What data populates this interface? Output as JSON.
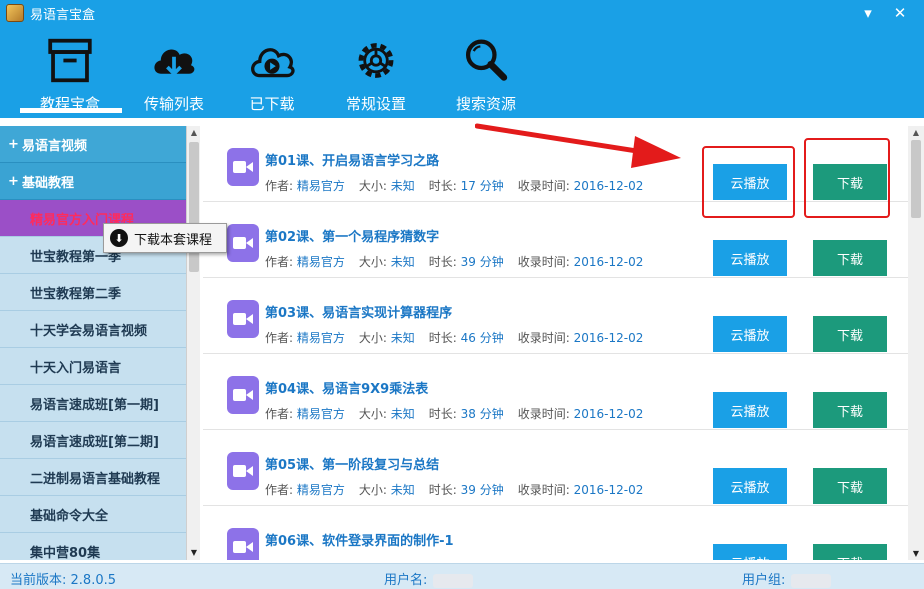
{
  "window": {
    "title": "易语言宝盒",
    "minimize_glyph": "▾",
    "close_glyph": "✕"
  },
  "toolbar": {
    "tabs": [
      {
        "label": "教程宝盒",
        "icon": "box-icon"
      },
      {
        "label": "传输列表",
        "icon": "cloud-download-icon"
      },
      {
        "label": "已下载",
        "icon": "cloud-play-icon"
      },
      {
        "label": "常规设置",
        "icon": "gear-icon"
      },
      {
        "label": "搜索资源",
        "icon": "search-icon"
      }
    ],
    "active_index": 0
  },
  "sidebar": {
    "groups": [
      {
        "label": "易语言视频",
        "expander": "+"
      },
      {
        "label": "基础教程",
        "expander": "+"
      }
    ],
    "items": [
      "精易官方入门课程",
      "世宝教程第一季",
      "世宝教程第二季",
      "十天学会易语言视频",
      "十天入门易语言",
      "易语言速成班[第一期]",
      "易语言速成班[第二期]",
      "二进制易语言基础教程",
      "基础命令大全",
      "集中营80集"
    ],
    "selected_index": 0
  },
  "context_menu": {
    "label": "下载本套课程"
  },
  "course_meta_labels": {
    "author": "作者:",
    "size": "大小:",
    "duration": "时长:",
    "date": "收录时间:"
  },
  "courses": [
    {
      "title": "第01课、开启易语言学习之路",
      "author": "精易官方",
      "size": "未知",
      "duration": "17 分钟",
      "date": "2016-12-02"
    },
    {
      "title": "第02课、第一个易程序猜数字",
      "author": "精易官方",
      "size": "未知",
      "duration": "39 分钟",
      "date": "2016-12-02"
    },
    {
      "title": "第03课、易语言实现计算器程序",
      "author": "精易官方",
      "size": "未知",
      "duration": "46 分钟",
      "date": "2016-12-02"
    },
    {
      "title": "第04课、易语言9X9乘法表",
      "author": "精易官方",
      "size": "未知",
      "duration": "38 分钟",
      "date": "2016-12-02"
    },
    {
      "title": "第05课、第一阶段复习与总结",
      "author": "精易官方",
      "size": "未知",
      "duration": "39 分钟",
      "date": "2016-12-02"
    },
    {
      "title": "第06课、软件登录界面的制作-1",
      "author": "",
      "size": "",
      "duration": "",
      "date": ""
    }
  ],
  "buttons": {
    "cloud_play": "云播放",
    "download": "下载"
  },
  "status": {
    "version_label": "当前版本:",
    "version": "2.8.0.5",
    "username_label": "用户名:",
    "usergroup_label": "用户组:"
  },
  "colors": {
    "accent": "#1aa0e6",
    "download": "#1c9a7c",
    "highlight_red": "#e31b1b",
    "video_icon": "#8d72e8"
  }
}
